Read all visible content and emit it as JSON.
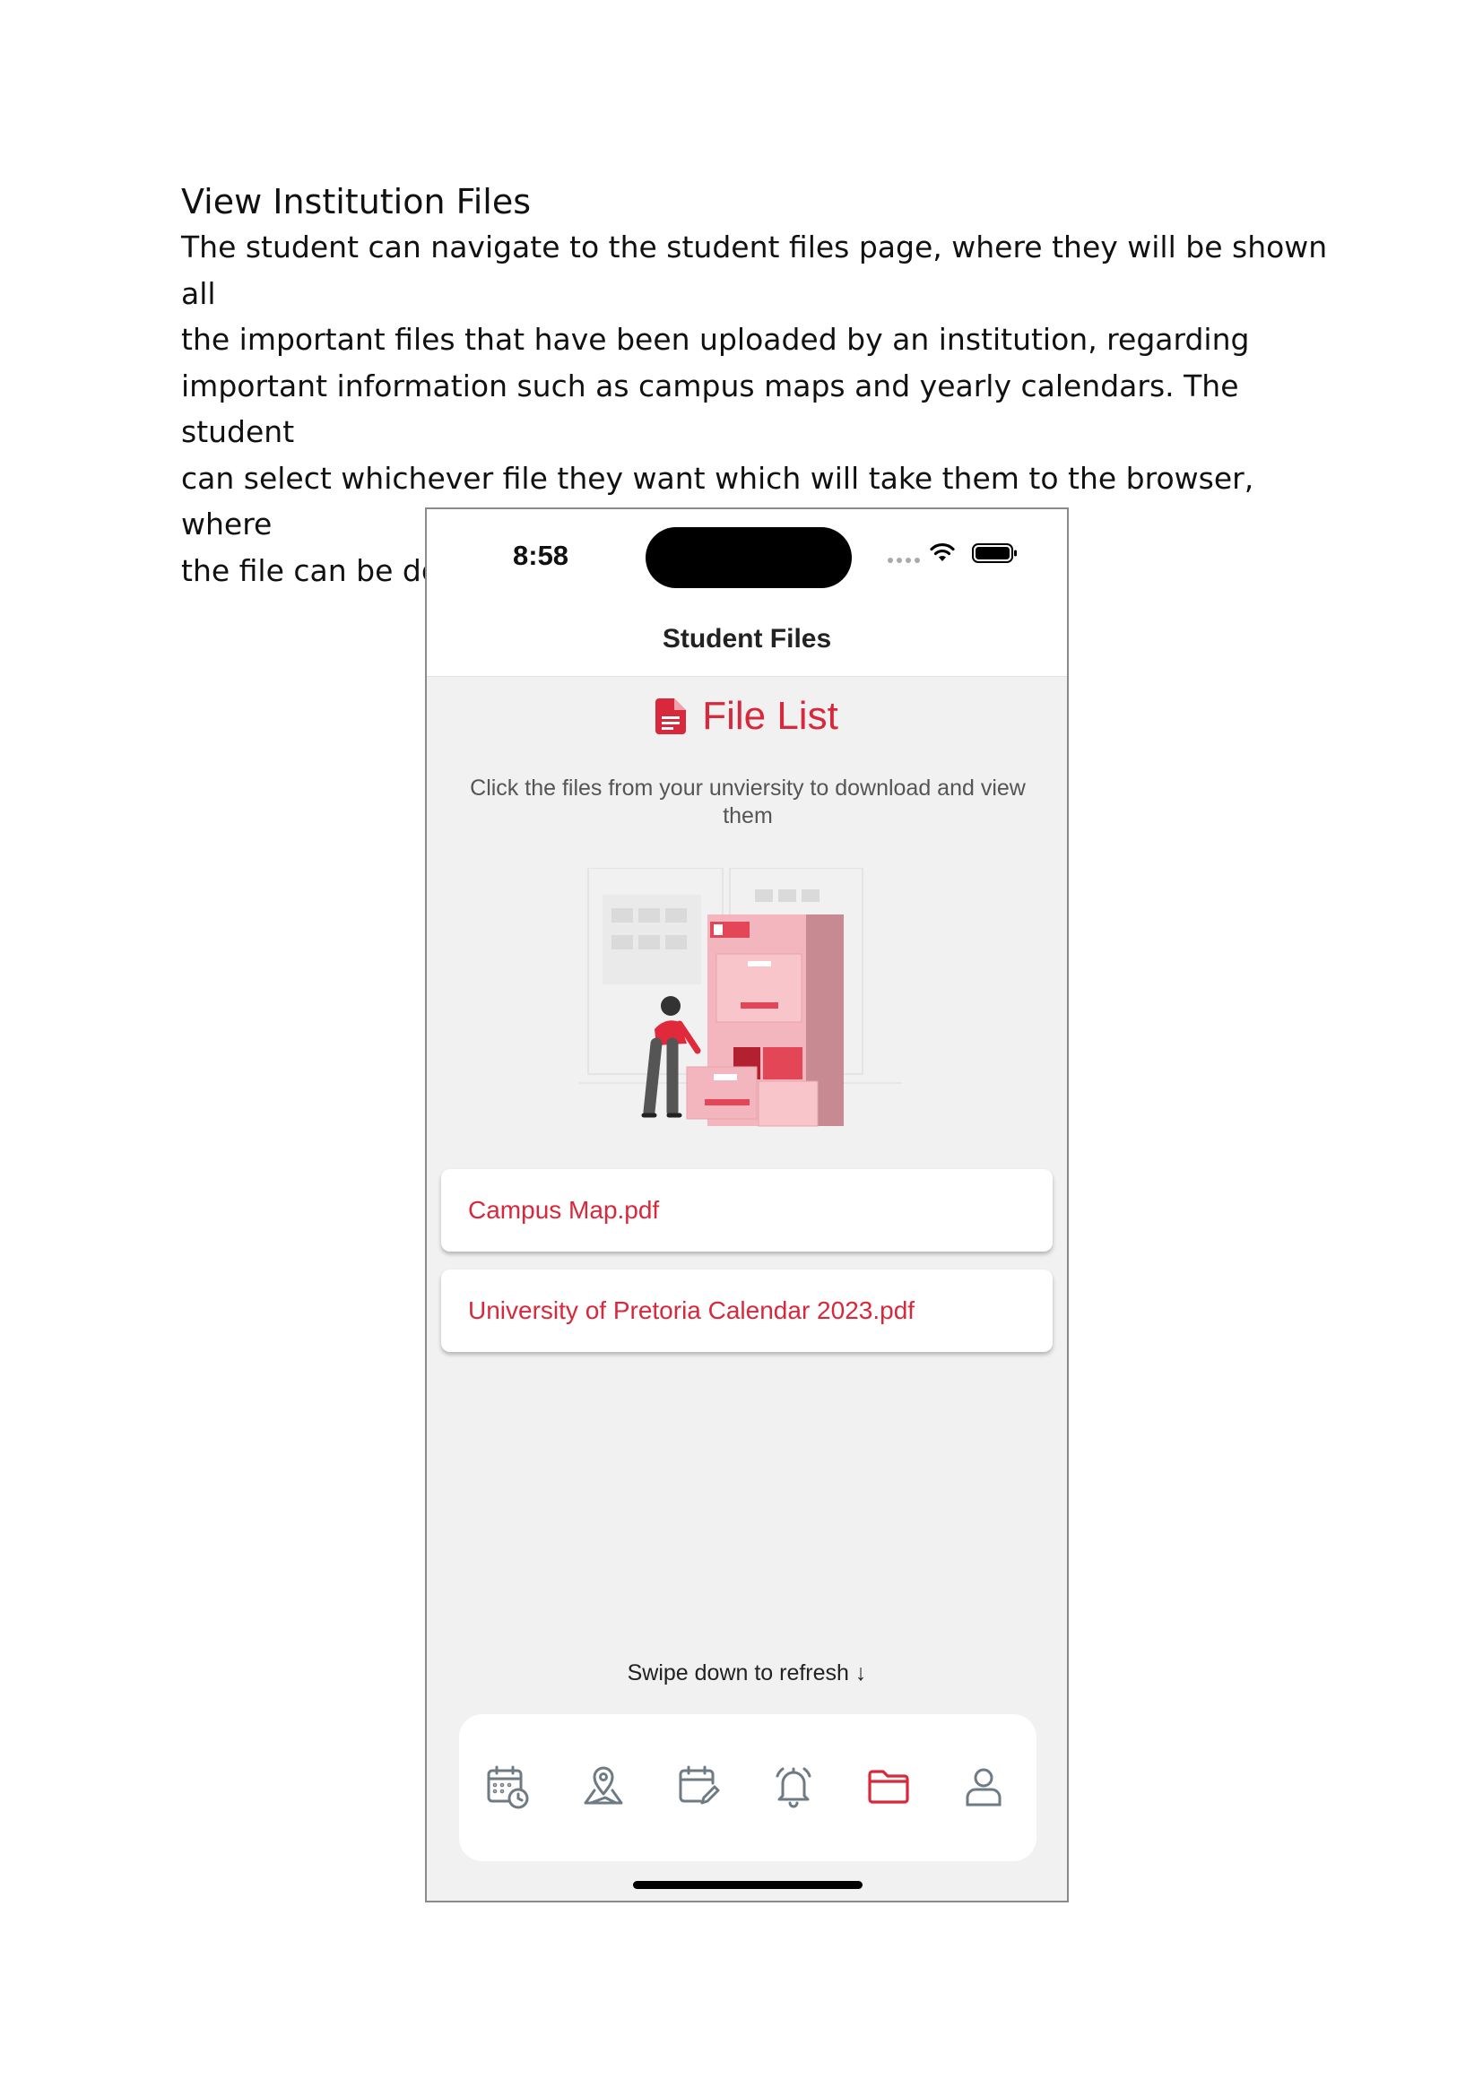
{
  "document": {
    "heading": "View Institution Files",
    "paragraph_lines": [
      "The student can navigate to the student files page, where they will be shown all",
      "the important files that have been uploaded by an institution, regarding",
      "important information such as campus maps and yearly calendars. The student",
      "can select whichever file they want which will take them to the browser, where",
      "the file can be downloaded."
    ]
  },
  "status_bar": {
    "time": "8:58"
  },
  "nav": {
    "title": "Student Files"
  },
  "page": {
    "header_icon": "file-document-icon",
    "header_title": "File List",
    "subtitle": "Click the files from your unviersity to download and view them",
    "illustration": "woman-filing-cabinet-illustration"
  },
  "files": [
    {
      "name": "Campus Map.pdf"
    },
    {
      "name": "University of Pretoria Calendar 2023.pdf"
    }
  ],
  "refresh_hint": "Swipe down to refresh ↓",
  "tab_bar": {
    "active_index": 4,
    "items": [
      {
        "icon": "calendar-clock-icon"
      },
      {
        "icon": "map-pin-icon"
      },
      {
        "icon": "calendar-edit-icon"
      },
      {
        "icon": "bell-icon"
      },
      {
        "icon": "folder-icon"
      },
      {
        "icon": "user-icon"
      }
    ]
  },
  "colors": {
    "accent": "#d8283b",
    "inactive_icon": "#6e7b84",
    "background": "#f1f1f1"
  }
}
